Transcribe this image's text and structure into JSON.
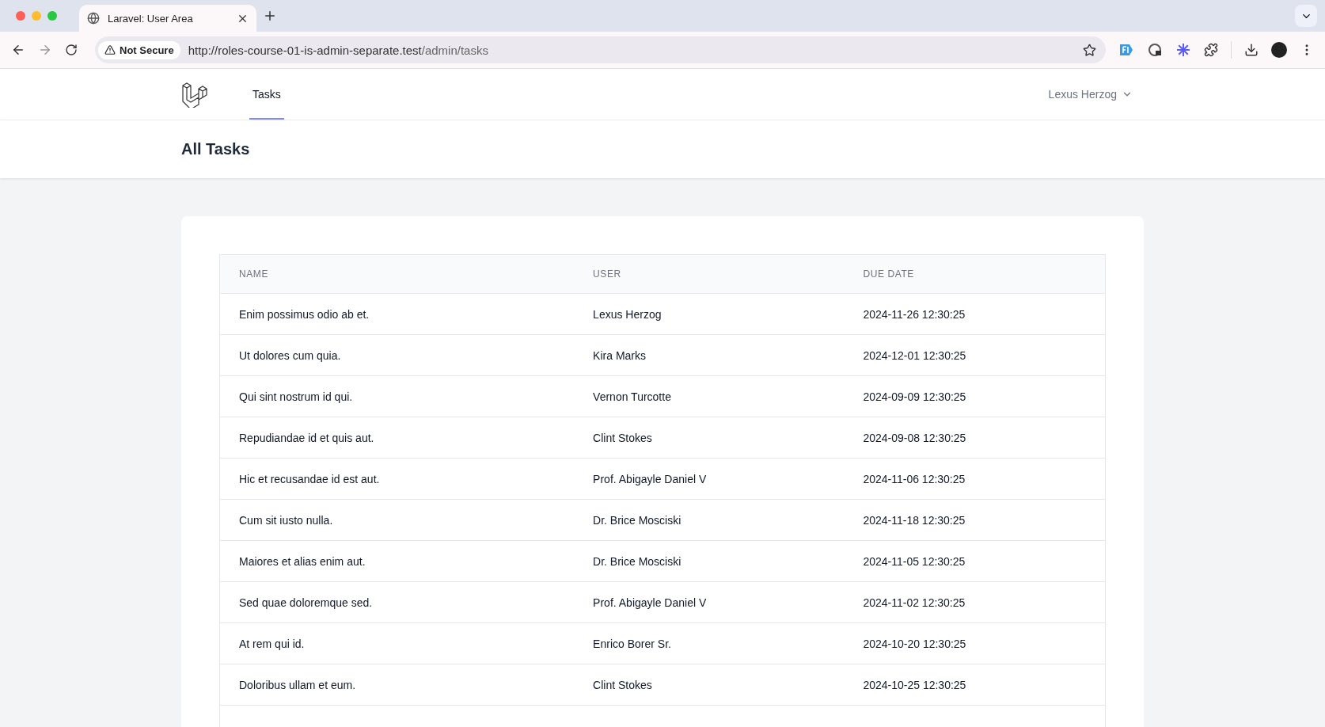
{
  "browser": {
    "tab_title": "Laravel: User Area",
    "security_label": "Not Secure",
    "url_host": "http://roles-course-01-is-admin-separate.test",
    "url_path": "/admin/tasks"
  },
  "nav": {
    "items": [
      {
        "label": "Tasks",
        "selected": true
      }
    ],
    "user_name": "Lexus Herzog"
  },
  "header": {
    "title": "All Tasks"
  },
  "table": {
    "columns": [
      "NAME",
      "USER",
      "DUE DATE"
    ],
    "rows": [
      [
        "Enim possimus odio ab et.",
        "Lexus Herzog",
        "2024-11-26 12:30:25"
      ],
      [
        "Ut dolores cum quia.",
        "Kira Marks",
        "2024-12-01 12:30:25"
      ],
      [
        "Qui sint nostrum id qui.",
        "Vernon Turcotte",
        "2024-09-09 12:30:25"
      ],
      [
        "Repudiandae id et quis aut.",
        "Clint Stokes",
        "2024-09-08 12:30:25"
      ],
      [
        "Hic et recusandae id est aut.",
        "Prof. Abigayle Daniel V",
        "2024-11-06 12:30:25"
      ],
      [
        "Cum sit iusto nulla.",
        "Dr. Brice Mosciski",
        "2024-11-18 12:30:25"
      ],
      [
        "Maiores et alias enim aut.",
        "Dr. Brice Mosciski",
        "2024-11-05 12:30:25"
      ],
      [
        "Sed quae doloremque sed.",
        "Prof. Abigayle Daniel V",
        "2024-11-02 12:30:25"
      ],
      [
        "At rem qui id.",
        "Enrico Borer Sr.",
        "2024-10-20 12:30:25"
      ],
      [
        "Doloribus ullam et eum.",
        "Clint Stokes",
        "2024-10-25 12:30:25"
      ]
    ]
  }
}
